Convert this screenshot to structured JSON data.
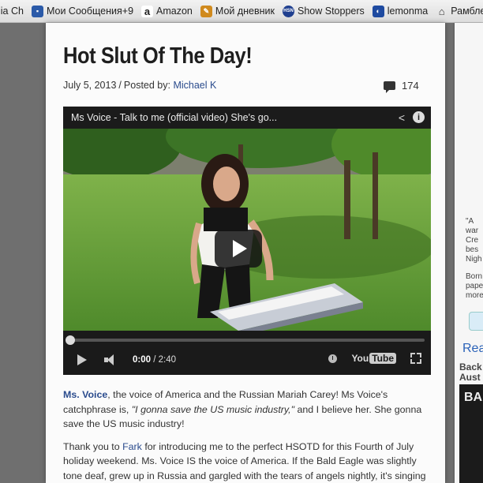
{
  "bookmarks": [
    {
      "label": "lia Ch",
      "icon": ""
    },
    {
      "label": "Мои Сообщения+9",
      "icon": "message-icon",
      "color": "#2b5aa8"
    },
    {
      "label": "Amazon",
      "icon": "amazon-icon",
      "color": "#222222"
    },
    {
      "label": "Мой дневник",
      "icon": "diary-icon",
      "color": "#d08a1e"
    },
    {
      "label": "Show Stoppers",
      "icon": "hsn-icon",
      "color": "#1f3f8f"
    },
    {
      "label": "lemonma",
      "icon": "lemonma-icon",
      "color": "#1e4aa0"
    },
    {
      "label": "Рамблер",
      "icon": "home-icon",
      "color": "#555555"
    }
  ],
  "article": {
    "title": "Hot Slut Of The Day!",
    "date": "July 5, 2013",
    "posted_by_label": "Posted by:",
    "author": "Michael K",
    "comment_count": "174"
  },
  "video": {
    "title": "Ms Voice - Talk to me (official video) She's go...",
    "current_time": "0:00",
    "duration": "2:40",
    "progress": 0,
    "logo": "You",
    "logo_tube": "Tube"
  },
  "body": {
    "p1_link": "Ms. Voice",
    "p1_text": ", the voice of America and the Russian Mariah Carey! Ms Voice's catchphrase is, ",
    "p1_quote": "\"I gonna save the US music industry,\"",
    "p1_end": " and I believe her. She gonna save the US music industry!",
    "p2_start": "Thank you to ",
    "p2_link": "Fark",
    "p2_text": " for introducing me to the perfect HSOTD for this Fourth of July holiday weekend. Ms. Voice IS the voice of America. If the Bald Eagle was slightly tone deaf, grew up in Russia and gargled with the tears of angels nightly, it's singing voice would sound exactly like Ms. Voice's singing voice."
  },
  "sidebar": {
    "quote_lines": [
      "\"A",
      "war",
      "Cre",
      "bes",
      "Nigh"
    ],
    "born_lines": [
      "Born",
      "pape",
      "more"
    ],
    "read_label": "Rea",
    "back_lines": [
      "Back",
      "Aust"
    ],
    "ad_text": "BA"
  }
}
